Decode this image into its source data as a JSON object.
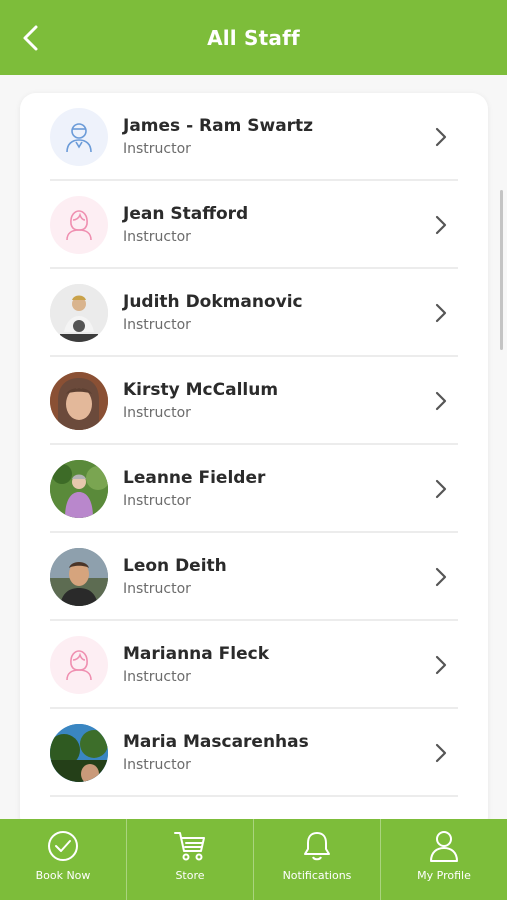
{
  "header": {
    "title": "All Staff",
    "back_icon": "chevron-left-icon",
    "background": "#7dbd3a"
  },
  "staff": [
    {
      "name": "James - Ram Swartz",
      "role": "Instructor",
      "avatar": "male-placeholder-icon",
      "avatar_bg": "#eef2fb",
      "avatar_color": "#6b9bd8"
    },
    {
      "name": "Jean Stafford",
      "role": "Instructor",
      "avatar": "female-placeholder-icon",
      "avatar_bg": "#fdeef3",
      "avatar_color": "#ef8fb0"
    },
    {
      "name": "Judith Dokmanovic",
      "role": "Instructor",
      "avatar": "photo",
      "avatar_bg": "#e8e8e8",
      "avatar_color": "#6f6f6f"
    },
    {
      "name": "Kirsty McCallum",
      "role": "Instructor",
      "avatar": "photo",
      "avatar_bg": "#a86a46",
      "avatar_color": "#e7c2a6"
    },
    {
      "name": "Leanne Fielder",
      "role": "Instructor",
      "avatar": "photo",
      "avatar_bg": "#4f7b33",
      "avatar_color": "#b88ac9"
    },
    {
      "name": "Leon Deith",
      "role": "Instructor",
      "avatar": "photo",
      "avatar_bg": "#6e7f8c",
      "avatar_color": "#d7a77f"
    },
    {
      "name": "Marianna Fleck",
      "role": "Instructor",
      "avatar": "female-placeholder-icon",
      "avatar_bg": "#fdeef3",
      "avatar_color": "#ef8fb0"
    },
    {
      "name": "Maria Mascarenhas",
      "role": "Instructor",
      "avatar": "photo",
      "avatar_bg": "#2f7db8",
      "avatar_color": "#2e5a23"
    }
  ],
  "tabbar": {
    "background": "#7dbd3a",
    "tabs": [
      {
        "label": "Book Now",
        "icon": "check-circle-icon"
      },
      {
        "label": "Store",
        "icon": "cart-icon"
      },
      {
        "label": "Notifications",
        "icon": "bell-icon"
      },
      {
        "label": "My Profile",
        "icon": "user-icon"
      }
    ]
  }
}
